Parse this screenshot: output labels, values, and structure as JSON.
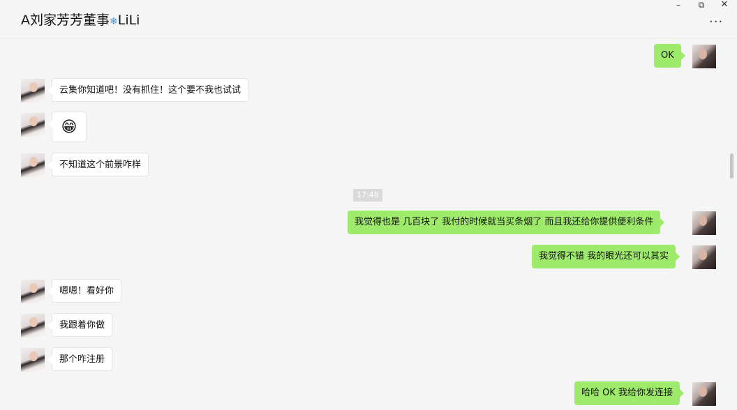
{
  "header": {
    "title_prefix": "A刘家芳芳董事",
    "title_deco": "❄",
    "title_suffix": "LiLi",
    "more_label": "···",
    "minimize_glyph": "–",
    "restore_glyph": "⧉",
    "close_glyph": "✕"
  },
  "timestamp": "17:48",
  "messages": [
    {
      "side": "out",
      "text": "OK"
    },
    {
      "side": "in",
      "text": "云集你知道吧！没有抓住！这个要不我也试试"
    },
    {
      "side": "in",
      "text": "😁"
    },
    {
      "side": "in",
      "text": "不知道这个前景咋样"
    },
    {
      "side": "out",
      "text": "我觉得也是 几百块了 我付的时候就当买条烟了 而且我还给你提供便利条件"
    },
    {
      "side": "out",
      "text": "我觉得不错 我的眼光还可以其实"
    },
    {
      "side": "in",
      "text": "嗯嗯！看好你"
    },
    {
      "side": "in",
      "text": "我跟着你做"
    },
    {
      "side": "in",
      "text": "那个咋注册"
    },
    {
      "side": "out",
      "text": "哈哈 OK 我给你发连接"
    }
  ],
  "colors": {
    "outgoing_bubble": "#9eea6a",
    "incoming_bubble": "#ffffff",
    "background": "#f5f5f5"
  }
}
